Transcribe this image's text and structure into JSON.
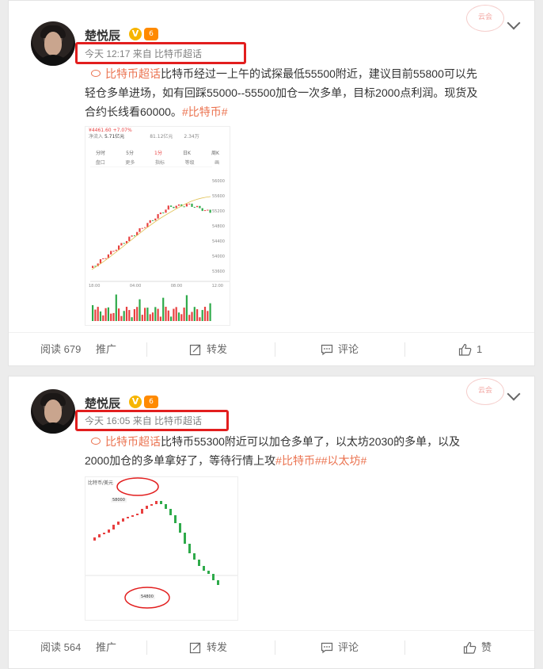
{
  "posts": [
    {
      "author": "楚悦辰",
      "badge_v": "V",
      "badge_level": "6",
      "stamp_text": "云会",
      "meta": "今天 12:17 来自 比特币超话",
      "topic": "比特币超话",
      "text_line1": "比特币经过一上午的试探最低55500附近，建议目前55800可以先",
      "text_line2": "轻仓多单进场，如有回踩55000--55500加仓一次多单，目标2000点利润。现货及",
      "text_line3": "合约长线看60000。",
      "hashtag": "#比特币#",
      "chart_header": {
        "price": "¥4461.60",
        "change": "+7.07%",
        "net_in_label": "净流入",
        "net_in": "5.71亿元",
        "vol": "81.12亿元",
        "count": "2.34万"
      },
      "chart_tabs": [
        "分时",
        "5分",
        "1分",
        "日K",
        "周K"
      ],
      "chart_subtabs": [
        "盘口",
        "更多",
        "指标",
        "等级",
        "画"
      ],
      "chart_right_labels": [
        "56000",
        "55600",
        "55200",
        "54800",
        "54400",
        "54000",
        "53600"
      ],
      "chart_bottom_labels": [
        "18:00",
        "04:00",
        "08:00",
        "12:00"
      ],
      "actions": {
        "read": "阅读 679",
        "promote": "推广",
        "repost": "转发",
        "comment": "评论",
        "like": "1"
      }
    },
    {
      "author": "楚悦辰",
      "badge_v": "V",
      "badge_level": "6",
      "stamp_text": "云会",
      "meta": "今天 16:05 来自 比特币超话",
      "topic": "比特币超话",
      "text_line1": "比特币55300附近可以加仓多单了，以太坊2030的多单，以及",
      "text_line2": "2000加仓的多单拿好了，等待行情上攻",
      "hashtags": "#比特币##以太坊#",
      "chart_title": "比特币/美元",
      "chart_top_value": "58000",
      "chart_bottom_value": "54800",
      "actions": {
        "read": "阅读 564",
        "promote": "推广",
        "repost": "转发",
        "comment": "评论",
        "like": "赞"
      }
    }
  ],
  "colors": {
    "link": "#eb7350",
    "highlight_box": "#e21e1e",
    "up_candle": "#e84040",
    "down_candle": "#2eaa4a"
  }
}
